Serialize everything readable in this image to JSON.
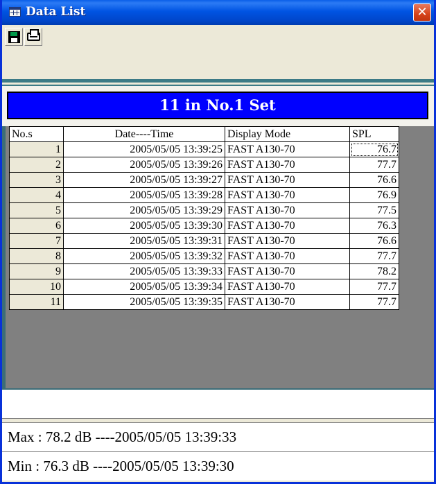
{
  "window": {
    "title": "Data List",
    "close_label": "✕"
  },
  "toolbar": {
    "buttons": [
      {
        "name": "save",
        "icon": "floppy-disk-icon"
      },
      {
        "name": "print",
        "icon": "printer-icon"
      }
    ]
  },
  "set_header": "11 in No.1 Set",
  "table": {
    "columns": [
      "No.s",
      "Date----Time",
      "Display Mode",
      "SPL"
    ],
    "rows": [
      {
        "no": "1",
        "datetime": "2005/05/05 13:39:25",
        "mode": "FAST A130-70",
        "spl": "76.7"
      },
      {
        "no": "2",
        "datetime": "2005/05/05 13:39:26",
        "mode": "FAST A130-70",
        "spl": "77.7"
      },
      {
        "no": "3",
        "datetime": "2005/05/05 13:39:27",
        "mode": "FAST A130-70",
        "spl": "76.6"
      },
      {
        "no": "4",
        "datetime": "2005/05/05 13:39:28",
        "mode": "FAST A130-70",
        "spl": "76.9"
      },
      {
        "no": "5",
        "datetime": "2005/05/05 13:39:29",
        "mode": "FAST A130-70",
        "spl": "77.5"
      },
      {
        "no": "6",
        "datetime": "2005/05/05 13:39:30",
        "mode": "FAST A130-70",
        "spl": "76.3"
      },
      {
        "no": "7",
        "datetime": "2005/05/05 13:39:31",
        "mode": "FAST A130-70",
        "spl": "76.6"
      },
      {
        "no": "8",
        "datetime": "2005/05/05 13:39:32",
        "mode": "FAST A130-70",
        "spl": "77.7"
      },
      {
        "no": "9",
        "datetime": "2005/05/05 13:39:33",
        "mode": "FAST A130-70",
        "spl": "78.2"
      },
      {
        "no": "10",
        "datetime": "2005/05/05 13:39:34",
        "mode": "FAST A130-70",
        "spl": "77.7"
      },
      {
        "no": "11",
        "datetime": "2005/05/05 13:39:35",
        "mode": "FAST A130-70",
        "spl": "77.7"
      }
    ]
  },
  "status": {
    "empty": "",
    "max": "Max : 78.2 dB ----2005/05/05 13:39:33",
    "min": "Min : 76.3 dB ----2005/05/05 13:39:30"
  },
  "colors": {
    "title_bar": "#0054e3",
    "set_banner": "#0000ff",
    "close_button": "#d6421a"
  }
}
